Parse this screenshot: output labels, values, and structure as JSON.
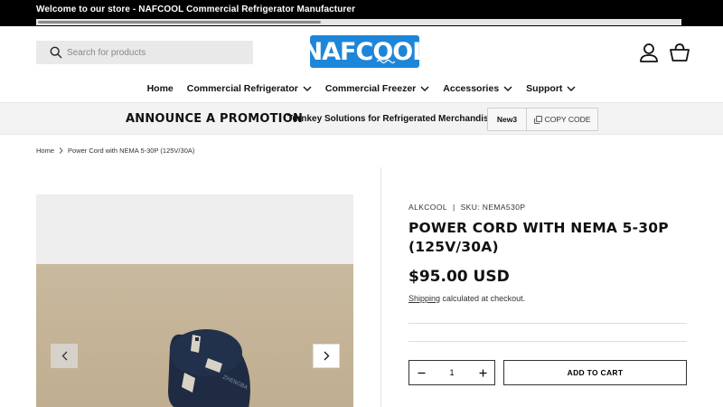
{
  "announcement": {
    "text": "Welcome to our store - NAFCOOL Commercial Refrigerator Manufacturer"
  },
  "header": {
    "search_placeholder": "Search for products",
    "logo_text": "NAFCOOL",
    "brand_color": "#1e86d9"
  },
  "nav": {
    "items": [
      {
        "label": "Home",
        "has_dropdown": false
      },
      {
        "label": "Commercial Refrigerator",
        "has_dropdown": true
      },
      {
        "label": "Commercial Freezer",
        "has_dropdown": true
      },
      {
        "label": "Accessories",
        "has_dropdown": true
      },
      {
        "label": "Support",
        "has_dropdown": true
      }
    ]
  },
  "promo": {
    "title": "ANNOUNCE A PROMOTION",
    "subtitle": "Turnkey Solutions for Refrigerated Merchandisers",
    "code": "New3",
    "copy_label": "COPY CODE"
  },
  "breadcrumb": {
    "home": "Home",
    "current": "Power Cord with NEMA 5-30P (125V/30A)"
  },
  "product": {
    "vendor": "ALKCOOL",
    "separator": "|",
    "sku": "SKU: NEMA530P",
    "title": "POWER CORD WITH NEMA 5-30P (125V/30A)",
    "price": "$95.00 USD",
    "shipping_link": "Shipping",
    "shipping_text": " calculated at checkout.",
    "quantity": "1",
    "add_to_cart": "ADD TO CART"
  },
  "icons": [
    "search-icon",
    "account-icon",
    "cart-icon",
    "chevron-down-icon",
    "copy-icon",
    "chevron-right-icon",
    "chevron-left-icon",
    "minus-icon",
    "plus-icon"
  ]
}
